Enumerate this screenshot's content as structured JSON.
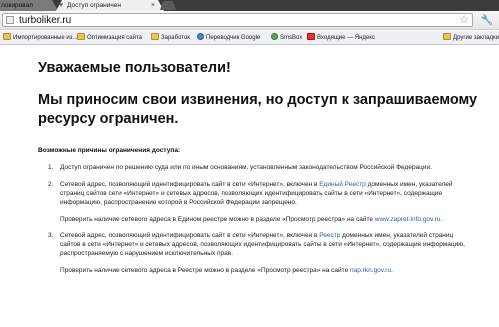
{
  "browser": {
    "tabs": [
      {
        "label": "локировал"
      },
      {
        "label": "Доступ ограничен"
      }
    ],
    "url": "turboliker.ru",
    "bookmarks": [
      {
        "label": "Импортированные из..."
      },
      {
        "label": "Оптимизация сайта"
      },
      {
        "label": "Заработок"
      },
      {
        "label": "Переводчик Google"
      },
      {
        "label": "SmsBox"
      },
      {
        "label": "Входящие — Яндекс"
      },
      {
        "label": "Другие закладки"
      }
    ]
  },
  "page": {
    "greeting": "Уважаемые пользователи!",
    "apology": "Мы приносим свои извинения, но доступ к запрашиваемому ресурсу ограничен.",
    "reasons_title": "Возможные причины ограничения доступа:",
    "reasons": [
      {
        "number": "1.",
        "text": "Доступ ограничен по решению суда или по иным основаниям, установленным законодательством Российской Федерации."
      },
      {
        "number": "2.",
        "text_before_link": "Сетевой адрес, позволяющий идентифицировать сайт в сети «Интернет», включен в ",
        "link": "Единый Реестр",
        "text_after_link": " доменных имен, указателей страниц сайтов сети «Интернет» и сетевых адресов, позволяющих идентифицировать сайты в сети «Интернет», содержащие информацию, распространение которой в Российской Федерации запрещено.",
        "check_text": "Проверить наличие сетевого адреса в Едином реестре можно в разделе «Просмотр реестра» на сайте ",
        "check_link": "www.zapret-info.gov.ru",
        "check_end": "."
      },
      {
        "number": "3.",
        "text_before_link": "Сетевой адрес, позволяющий идентифицировать сайт в сети «Интернет», включен в ",
        "link": "Реестр",
        "text_after_link": " доменных имен, указателей страниц сайтов в сети «Интернет» и сетевых адресов, позволяющих идентифицировать сайты в сети «Интернет», содержащие информацию, распространяемую с нарушением исключительных прав.",
        "check_text": "Проверить наличие сетевого адреса в Реестре можно в разделе «Просмотр реестра» на сайте ",
        "check_link": "nap.rkn.gov.ru",
        "check_end": "."
      }
    ]
  }
}
